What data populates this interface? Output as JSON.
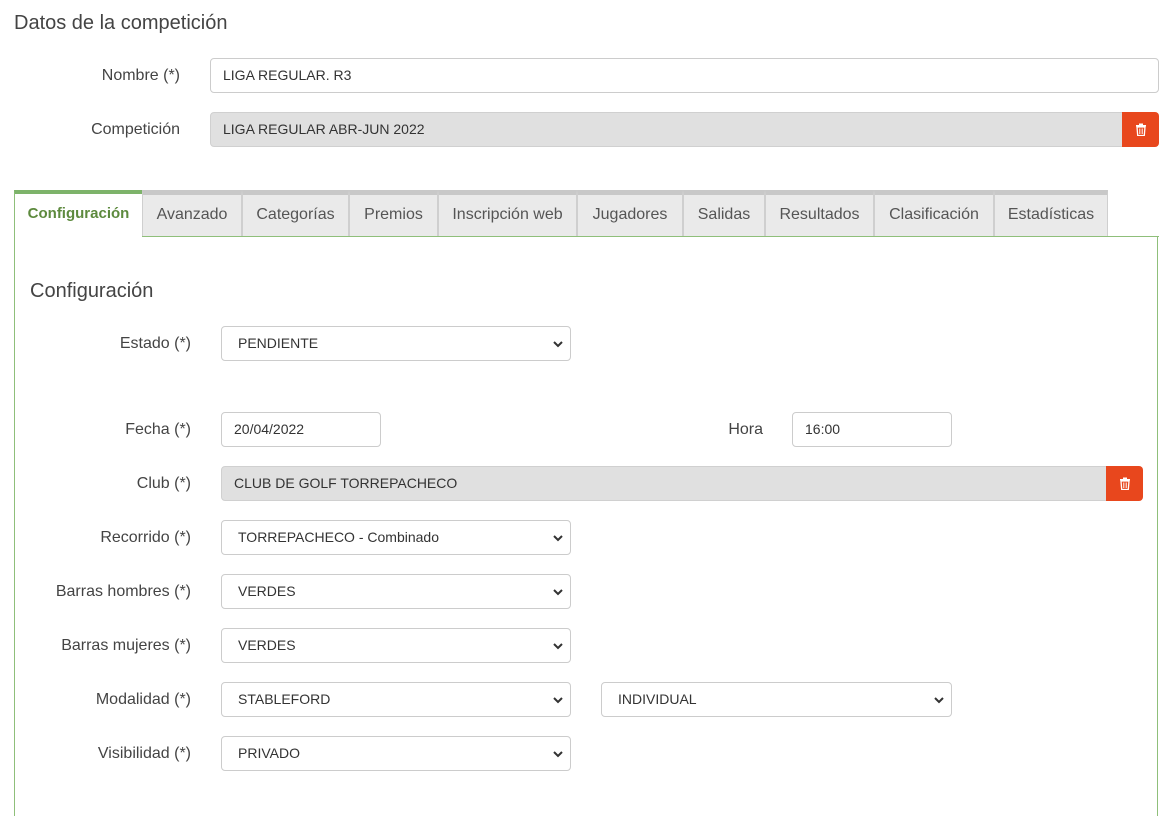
{
  "header": {
    "title": "Datos de la competición"
  },
  "form": {
    "nombre": {
      "label": "Nombre (*)",
      "value": "LIGA REGULAR. R3"
    },
    "competicion": {
      "label": "Competición",
      "value": "LIGA REGULAR ABR-JUN 2022"
    }
  },
  "tabs": [
    {
      "label": "Configuración",
      "active": true
    },
    {
      "label": "Avanzado"
    },
    {
      "label": "Categorías"
    },
    {
      "label": "Premios"
    },
    {
      "label": "Inscripción web"
    },
    {
      "label": "Jugadores"
    },
    {
      "label": "Salidas"
    },
    {
      "label": "Resultados"
    },
    {
      "label": "Clasificación"
    },
    {
      "label": "Estadísticas"
    }
  ],
  "config": {
    "title": "Configuración",
    "estado": {
      "label": "Estado (*)",
      "value": "PENDIENTE"
    },
    "fecha": {
      "label": "Fecha (*)",
      "value": "20/04/2022"
    },
    "hora": {
      "label": "Hora",
      "value": "16:00"
    },
    "club": {
      "label": "Club (*)",
      "value": "CLUB DE GOLF TORREPACHECO"
    },
    "recorrido": {
      "label": "Recorrido (*)",
      "value": "TORREPACHECO - Combinado"
    },
    "barras_hombres": {
      "label": "Barras hombres (*)",
      "value": "VERDES"
    },
    "barras_mujeres": {
      "label": "Barras mujeres (*)",
      "value": "VERDES"
    },
    "modalidad": {
      "label": "Modalidad (*)",
      "value": "STABLEFORD",
      "value2": "INDIVIDUAL"
    },
    "visibilidad": {
      "label": "Visibilidad (*)",
      "value": "PRIVADO"
    }
  },
  "colors": {
    "accent": "#7db36a",
    "danger": "#e8471d",
    "readonly_bg": "#e0e0e0"
  },
  "icons": {
    "delete": "trash-icon",
    "dropdown": "chevron-down-icon"
  }
}
